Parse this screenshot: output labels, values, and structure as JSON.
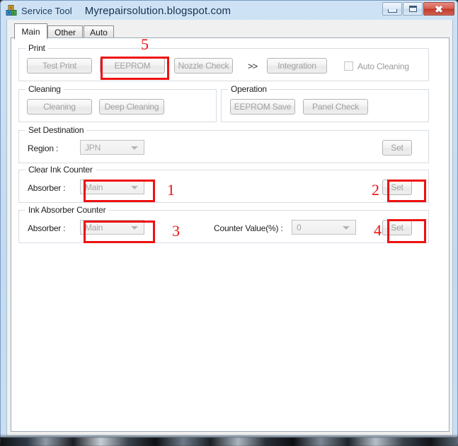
{
  "window": {
    "app_name": "Service Tool",
    "document_title": "Myrepairsolution.blogspot.com",
    "icon": "blocks-icon",
    "buttons": {
      "minimize": "minimize-icon",
      "maximize": "maximize-icon",
      "close_label": "✖"
    }
  },
  "tabs": [
    {
      "label": "Main",
      "active": true
    },
    {
      "label": "Other",
      "active": false
    },
    {
      "label": "Auto",
      "active": false
    }
  ],
  "groups": {
    "print": {
      "legend": "Print",
      "buttons": {
        "test_print": "Test Print",
        "eeprom": "EEPROM",
        "nozzle_check": "Nozzle Check",
        "integration": "Integration"
      },
      "separator": ">>",
      "auto_cleaning": {
        "label": "Auto Cleaning",
        "checked": false
      }
    },
    "cleaning": {
      "legend": "Cleaning",
      "buttons": {
        "cleaning": "Cleaning",
        "deep_cleaning": "Deep Cleaning"
      }
    },
    "operation": {
      "legend": "Operation",
      "buttons": {
        "eeprom_save": "EEPROM Save",
        "panel_check": "Panel Check"
      }
    },
    "set_destination": {
      "legend": "Set Destination",
      "region_label": "Region :",
      "region_value": "JPN",
      "set_label": "Set"
    },
    "clear_ink_counter": {
      "legend": "Clear Ink Counter",
      "absorber_label": "Absorber :",
      "absorber_value": "Main",
      "set_label": "Set"
    },
    "ink_absorber_counter": {
      "legend": "Ink Absorber Counter",
      "absorber_label": "Absorber :",
      "absorber_value": "Main",
      "counter_label": "Counter Value(%) :",
      "counter_value": "0",
      "set_label": "Set"
    }
  },
  "annotations": {
    "color": "#ee1111",
    "markers": [
      {
        "number": "1",
        "target": "clear-ink-counter-absorber-combo"
      },
      {
        "number": "2",
        "target": "clear-ink-counter-set-button"
      },
      {
        "number": "3",
        "target": "ink-absorber-counter-absorber-combo"
      },
      {
        "number": "4",
        "target": "ink-absorber-counter-set-button"
      },
      {
        "number": "5",
        "target": "eeprom-button"
      }
    ]
  }
}
